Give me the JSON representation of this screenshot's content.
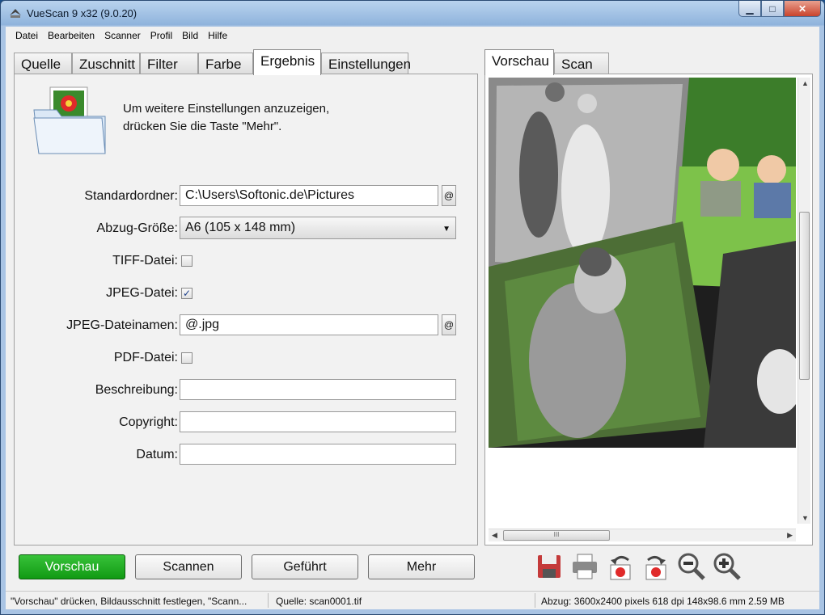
{
  "window": {
    "title": "VueScan 9 x32 (9.0.20)",
    "minimize": "▁",
    "maximize": "□",
    "close": "✕"
  },
  "menu": [
    "Datei",
    "Bearbeiten",
    "Scanner",
    "Profil",
    "Bild",
    "Hilfe"
  ],
  "left_tabs": [
    "Quelle",
    "Zuschnitt",
    "Filter",
    "Farbe",
    "Ergebnis",
    "Einstellungen"
  ],
  "active_left_tab": "Ergebnis",
  "right_tabs": [
    "Vorschau",
    "Scan"
  ],
  "active_right_tab": "Vorschau",
  "hint": {
    "line1": "Um weitere Einstellungen anzuzeigen,",
    "line2": "drücken Sie die Taste \"Mehr\"."
  },
  "form": {
    "standardordner_label": "Standardordner:",
    "standardordner_value": "C:\\Users\\Softonic.de\\Pictures",
    "abzug_label": "Abzug-Größe:",
    "abzug_value": "A6 (105 x 148 mm)",
    "tiff_label": "TIFF-Datei:",
    "tiff_checked": false,
    "jpeg_label": "JPEG-Datei:",
    "jpeg_checked": true,
    "jpeg_name_label": "JPEG-Dateinamen:",
    "jpeg_name_value": "@.jpg",
    "pdf_label": "PDF-Datei:",
    "pdf_checked": false,
    "beschreibung_label": "Beschreibung:",
    "beschreibung_value": "",
    "copyright_label": "Copyright:",
    "copyright_value": "",
    "datum_label": "Datum:",
    "datum_value": "",
    "at_button": "@"
  },
  "buttons": {
    "vorschau": "Vorschau",
    "scannen": "Scannen",
    "gefuehrt": "Geführt",
    "mehr": "Mehr"
  },
  "toolbar_icons": [
    "save-icon",
    "print-icon",
    "rotate-left-icon",
    "rotate-right-icon",
    "zoom-out-icon",
    "zoom-in-icon"
  ],
  "scroll": {
    "thumb_grip": "III"
  },
  "status": {
    "hint": "\"Vorschau\" drücken, Bildausschnitt festlegen, \"Scann...",
    "source": "Quelle: scan0001.tif",
    "output": "Abzug: 3600x2400 pixels 618 dpi 148x98.6 mm 2.59 MB"
  },
  "colors": {
    "accent_green": "#119a13",
    "title_blue": "#8fb3dc"
  }
}
